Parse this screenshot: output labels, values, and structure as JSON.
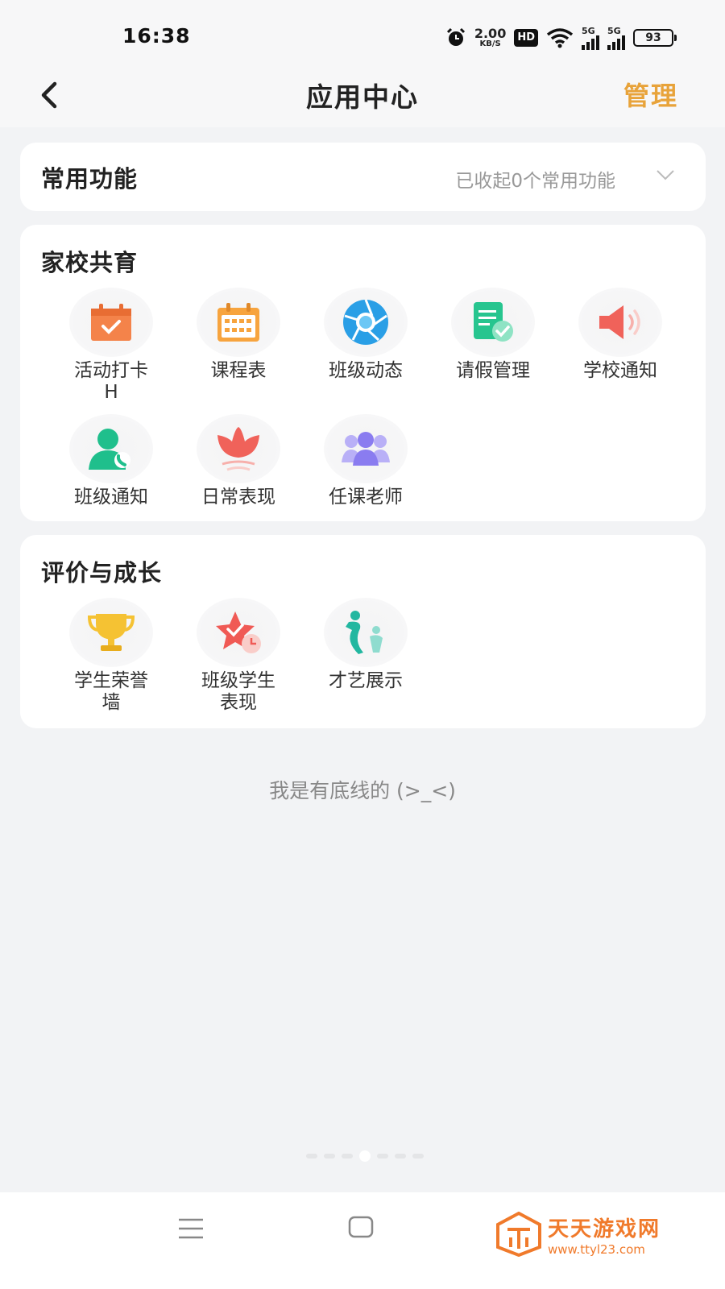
{
  "status_bar": {
    "time": "16:38",
    "speed_value": "2.00",
    "speed_unit": "KB/S",
    "hd": "HD",
    "sim1": "5G",
    "sim2": "5G",
    "battery": "93"
  },
  "header": {
    "title": "应用中心",
    "manage": "管理",
    "back_icon": "chevron-left-icon"
  },
  "common": {
    "title": "常用功能",
    "collapsed_note": "已收起0个常用功能"
  },
  "home_school": {
    "title": "家校共育",
    "apps": [
      {
        "label": "活动打卡",
        "label2": "H",
        "icon": "calendar-check-icon",
        "color": "#f4834a"
      },
      {
        "label": "课程表",
        "label2": "",
        "icon": "timetable-icon",
        "color": "#f7a43e"
      },
      {
        "label": "班级动态",
        "label2": "",
        "icon": "camera-aperture-icon",
        "color": "#2a9fe6"
      },
      {
        "label": "请假管理",
        "label2": "",
        "icon": "leave-form-icon",
        "color": "#27c58f"
      },
      {
        "label": "学校通知",
        "label2": "",
        "icon": "megaphone-icon",
        "color": "#f0625a"
      },
      {
        "label": "班级通知",
        "label2": "",
        "icon": "contact-phone-icon",
        "color": "#1fbf8c"
      },
      {
        "label": "日常表现",
        "label2": "",
        "icon": "lotus-icon",
        "color": "#f0625a"
      },
      {
        "label": "任课老师",
        "label2": "",
        "icon": "teachers-group-icon",
        "color": "#8a7cf0"
      }
    ]
  },
  "growth": {
    "title": "评价与成长",
    "apps": [
      {
        "label": "学生荣誉",
        "label2": "墙",
        "icon": "trophy-icon",
        "color": "#f5c233"
      },
      {
        "label": "班级学生",
        "label2": "表现",
        "icon": "star-clock-icon",
        "color": "#f05a55"
      },
      {
        "label": "才艺展示",
        "label2": "",
        "icon": "dancer-icon",
        "color": "#22b7a0"
      }
    ]
  },
  "footer_note": "我是有底线的 (>_<)",
  "watermark": {
    "main": "天天游戏网",
    "sub": "www.ttyl23.com"
  }
}
